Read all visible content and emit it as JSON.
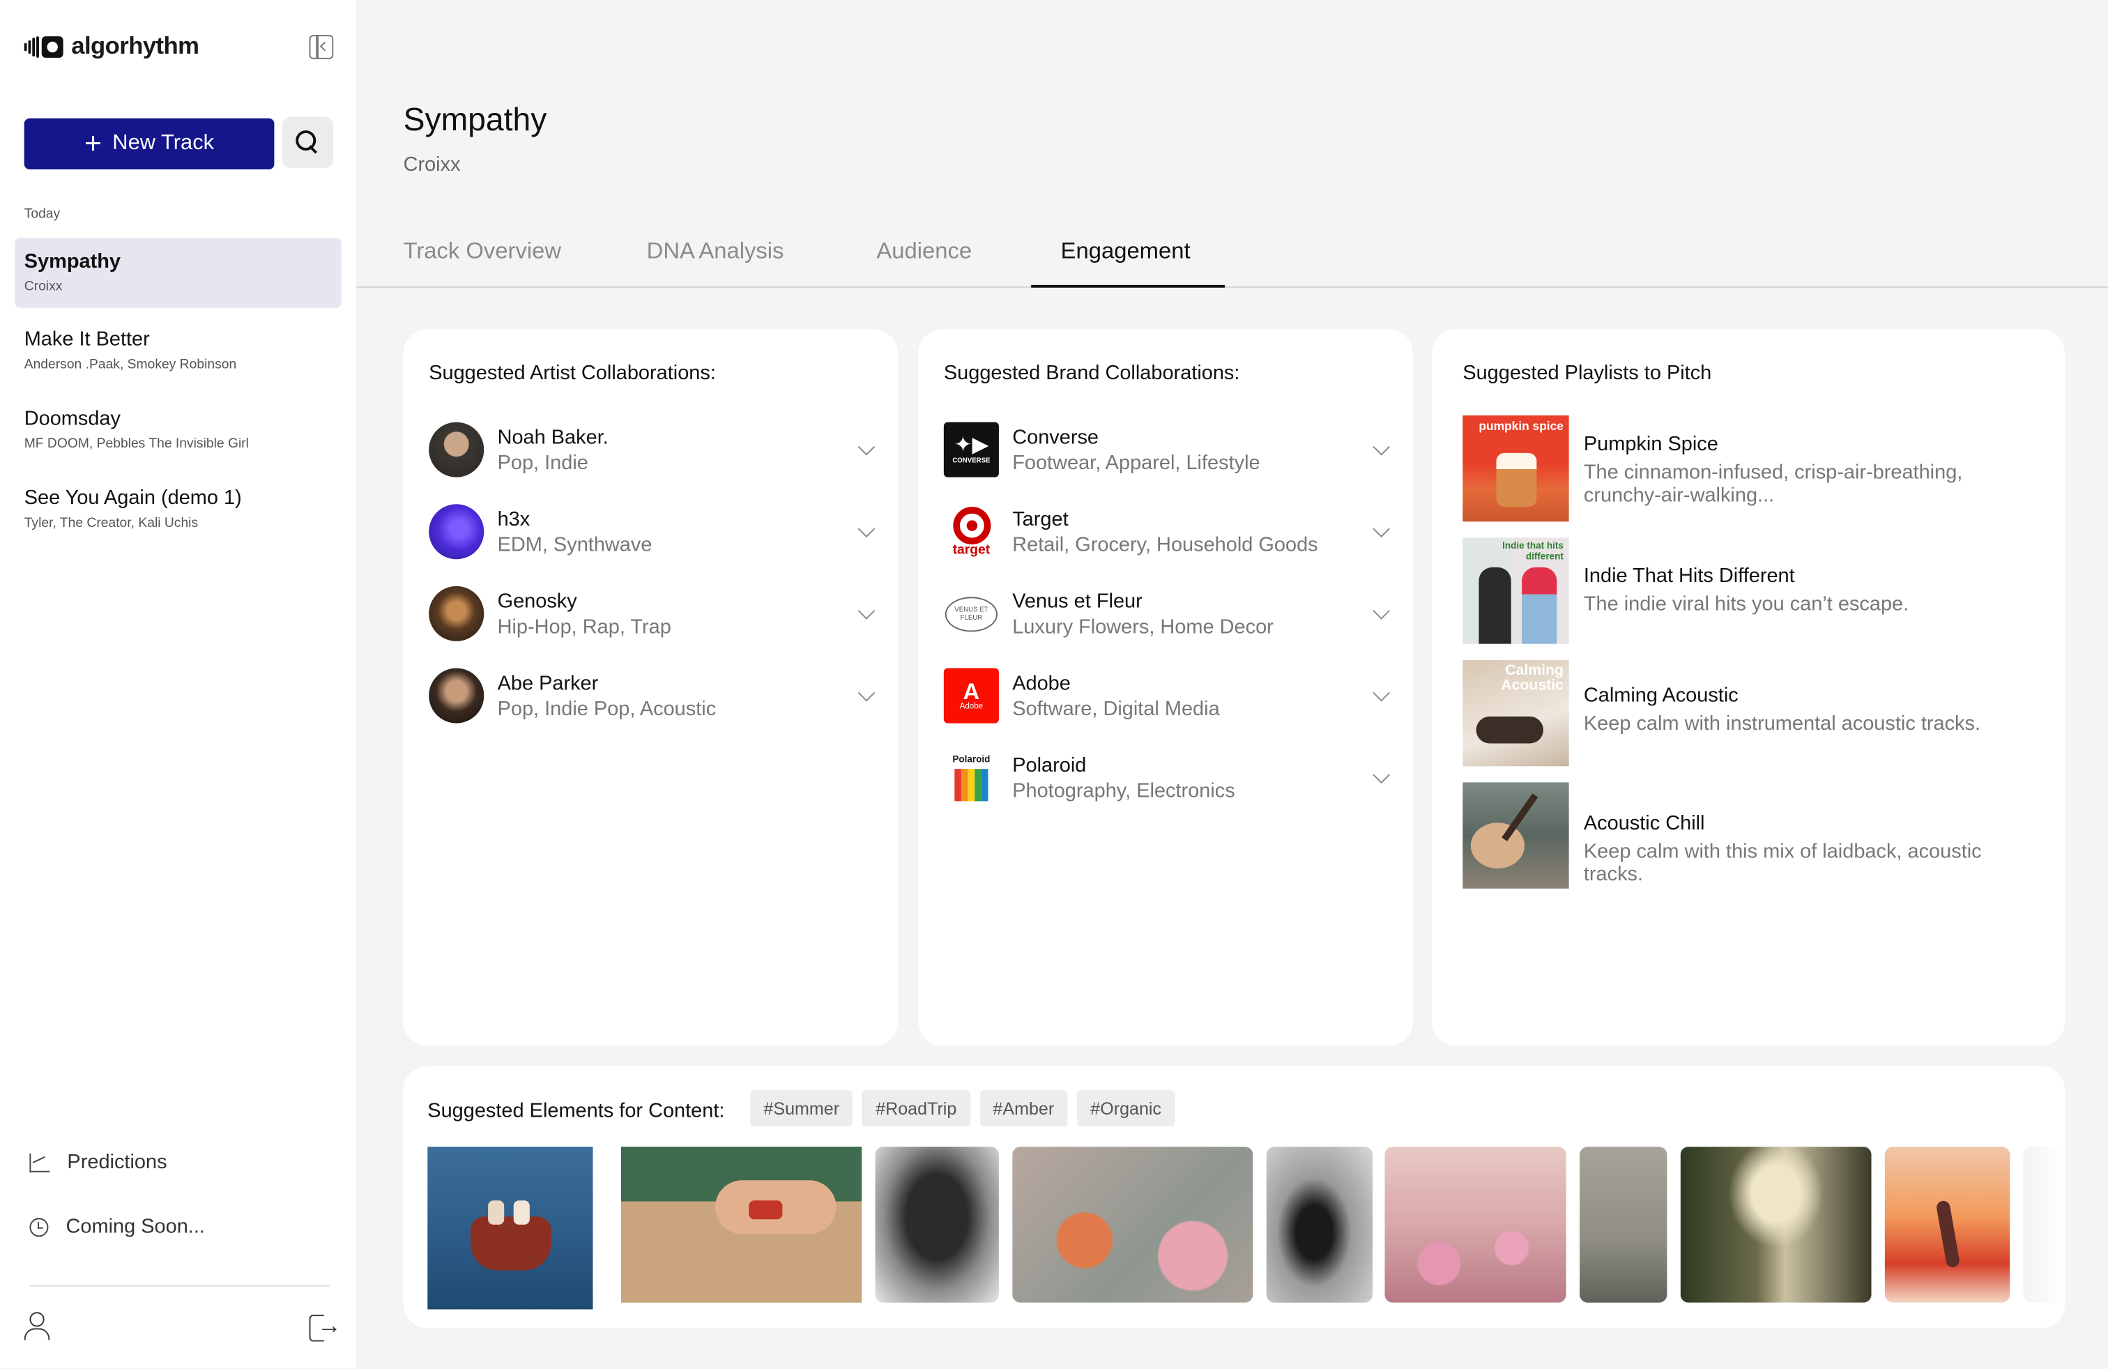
{
  "app": {
    "name": "algorhythm"
  },
  "sidebar": {
    "new_track_label": "New Track",
    "section_label": "Today",
    "tracks": [
      {
        "title": "Sympathy",
        "artist": "Croixx"
      },
      {
        "title": "Make It Better",
        "artist": "Anderson .Paak, Smokey Robinson"
      },
      {
        "title": "Doomsday",
        "artist": "MF DOOM, Pebbles The Invisible Girl"
      },
      {
        "title": "See You Again (demo 1)",
        "artist": "Tyler, The Creator, Kali Uchis"
      }
    ],
    "bottom_items": [
      {
        "label": "Predictions",
        "icon": "chart-icon"
      },
      {
        "label": "Coming Soon...",
        "icon": "clock-icon"
      }
    ]
  },
  "main": {
    "title": "Sympathy",
    "artist": "Croixx",
    "tabs": [
      "Track Overview",
      "DNA Analysis",
      "Audience",
      "Engagement"
    ],
    "active_tab": "Engagement"
  },
  "artists": {
    "heading": "Suggested Artist Collaborations:",
    "items": [
      {
        "name": "Noah Baker.",
        "genres": "Pop, Indie"
      },
      {
        "name": "h3x",
        "genres": "EDM, Synthwave"
      },
      {
        "name": "Genosky",
        "genres": "Hip-Hop, Rap, Trap"
      },
      {
        "name": "Abe Parker",
        "genres": "Pop, Indie Pop, Acoustic"
      }
    ]
  },
  "brands": {
    "heading": "Suggested Brand Collaborations:",
    "items": [
      {
        "name": "Converse",
        "categories": "Footwear, Apparel, Lifestyle",
        "logo_text": "CONVERSE"
      },
      {
        "name": "Target",
        "categories": "Retail, Grocery, Household Goods",
        "logo_text": "target"
      },
      {
        "name": "Venus et Fleur",
        "categories": "Luxury Flowers, Home Decor",
        "logo_text": "VENUS ET FLEUR"
      },
      {
        "name": "Adobe",
        "categories": "Software, Digital Media",
        "logo_text": "Adobe"
      },
      {
        "name": "Polaroid",
        "categories": "Photography, Electronics",
        "logo_text": "Polaroid"
      }
    ]
  },
  "playlists": {
    "heading": "Suggested Playlists to Pitch",
    "items": [
      {
        "name": "Pumpkin Spice",
        "description": "The cinnamon-infused, crisp-air-breathing, crunchy-air-walking...",
        "cover_text": "pumpkin spice"
      },
      {
        "name": "Indie That Hits Different",
        "description": "The indie viral hits you can’t escape.",
        "cover_text": "Indie that hits different"
      },
      {
        "name": "Calming Acoustic",
        "description": "Keep calm with instrumental acoustic tracks.",
        "cover_text": "Calming Acoustic"
      },
      {
        "name": "Acoustic Chill",
        "description": "Keep calm with this mix of laidback, acoustic tracks.",
        "cover_text": ""
      }
    ]
  },
  "content": {
    "heading": "Suggested Elements for Content:",
    "tags": [
      "#Summer",
      "#RoadTrip",
      "#Amber",
      "#Organic"
    ]
  },
  "colors": {
    "accent": "#14168a",
    "active_track_bg": "#e6e6f0",
    "background": "#f4f4f4"
  }
}
